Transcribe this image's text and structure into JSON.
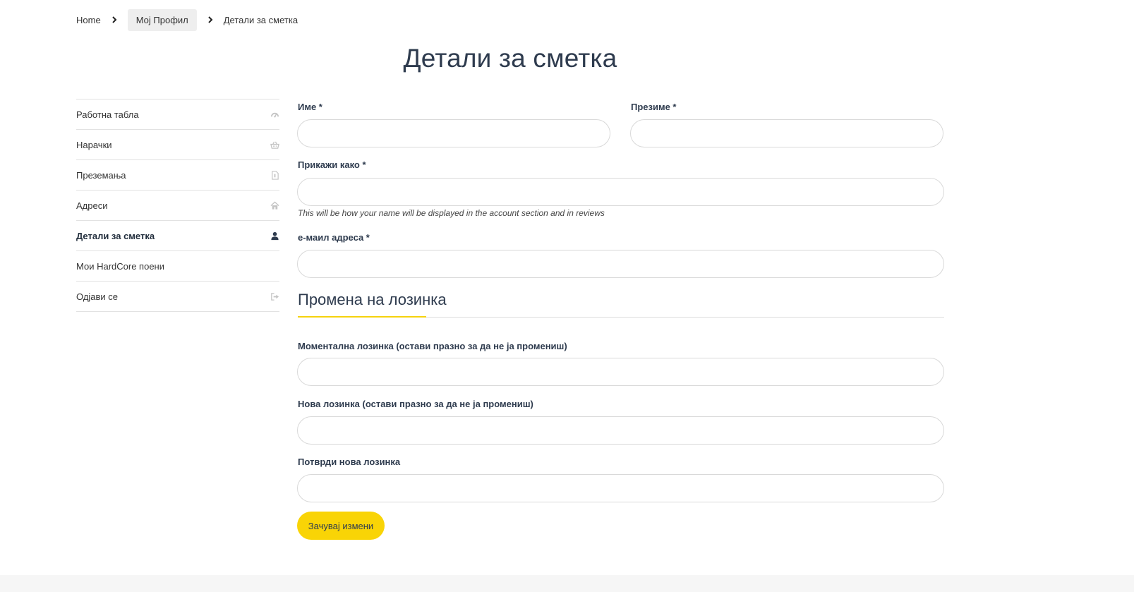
{
  "breadcrumb": {
    "items": [
      "Home",
      "Мој Профил",
      "Детали за сметка"
    ]
  },
  "page": {
    "title": "Детали за сметка"
  },
  "sidebar": {
    "items": [
      {
        "label": "Работна табла",
        "icon": "dashboard-icon"
      },
      {
        "label": "Нарачки",
        "icon": "basket-icon"
      },
      {
        "label": "Преземања",
        "icon": "file-icon"
      },
      {
        "label": "Адреси",
        "icon": "home-icon"
      },
      {
        "label": "Детали за сметка",
        "icon": "user-icon",
        "active": true
      },
      {
        "label": "Мои HardCore поени",
        "icon": ""
      },
      {
        "label": "Одјави се",
        "icon": "sign-out-icon"
      }
    ]
  },
  "form": {
    "first_name": {
      "label": "Име  *",
      "value": ""
    },
    "last_name": {
      "label": "Презиме *",
      "value": ""
    },
    "display_name": {
      "label": "Прикажи како *",
      "value": "",
      "hint": "This will be how your name will be displayed in the account section and in reviews"
    },
    "email": {
      "label": "е-маил адреса *",
      "value": ""
    },
    "password_section": {
      "title": "Промена на лозинка",
      "current": {
        "label": "Моментална лозинка (остави празно за да не ја промениш)",
        "value": ""
      },
      "new": {
        "label": "Нова лозинка (остави празно за да не ја промениш)",
        "value": ""
      },
      "confirm": {
        "label": "Потврди нова лозинка",
        "value": ""
      }
    },
    "save_label": "Зачувај измени"
  },
  "colors": {
    "accent": "#f9d406",
    "text": "#2e3b4e",
    "border": "#d9d9d9",
    "icon_muted": "#c4c4c4"
  }
}
